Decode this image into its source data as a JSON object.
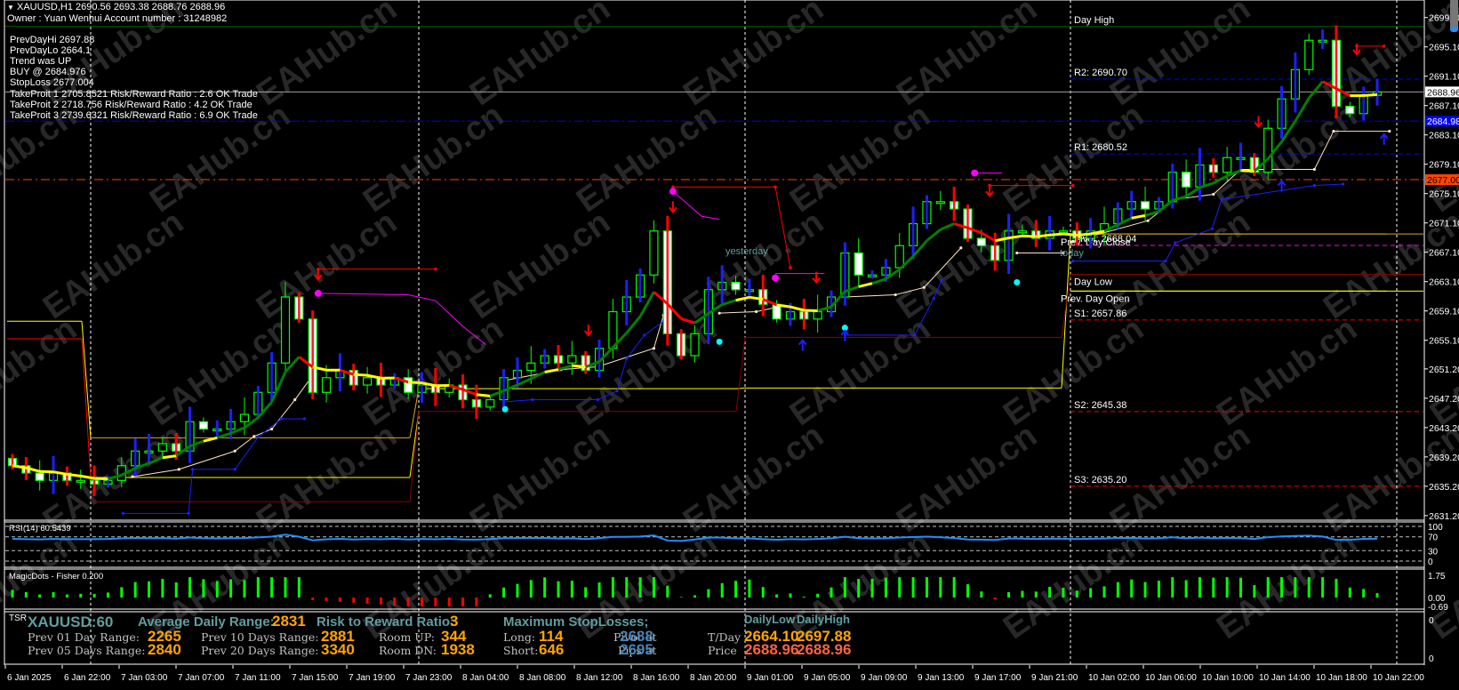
{
  "header": {
    "symbol_line": "XAUUSD,H1  2690.56 2693.38 2688.76 2688.96",
    "owner_line": "Owner : Yuan Wenhui Account number : 31248982"
  },
  "info_lines": [
    "PrevDayHi 2697.88",
    "PrevDayLo 2664.1",
    "Trend was UP",
    "BUY @ 2684.976",
    "StopLoss 2677.004",
    "TakeProit 1 2705.8521 Risk/Reward Ratio : 2.6 OK Trade",
    "TakeProit 2 2718.756 Risk/Reward Ratio : 4.2 OK Trade",
    "TakeProit 3 2739.6321 Risk/Reward Ratio : 6.9 OK Trade"
  ],
  "watermark": "EAHub.cn",
  "colors": {
    "bull_wick": "#1e1eff",
    "bear_wick": "#ff0000",
    "body_outline": "#00ff00",
    "ma_up": "#008000",
    "ma_down": "#ff0000",
    "ma_flat": "#ffff00"
  },
  "chart_data": {
    "type": "candlestick",
    "symbol": "XAUUSD",
    "timeframe": "H1",
    "closes": [
      2638,
      2637,
      2636,
      2637,
      2636,
      2636,
      2635.5,
      2636,
      2638,
      2640,
      2640,
      2641,
      2640,
      2644,
      2643,
      2643,
      2644,
      2645,
      2648,
      2652,
      2661,
      2658,
      2648,
      2650,
      2651,
      2649,
      2650,
      2649,
      2650,
      2648,
      2649,
      2648,
      2649,
      2647,
      2646,
      2647,
      2650,
      2651,
      2652,
      2653,
      2652,
      2653,
      2651,
      2654,
      2659,
      2661,
      2664,
      2670,
      2656,
      2653,
      2656,
      2662,
      2663,
      2662,
      2662,
      2660,
      2658,
      2659,
      2658,
      2659,
      2661,
      2667,
      2664,
      2664,
      2665,
      2668,
      2671,
      2674,
      2674,
      2673,
      2669,
      2668,
      2666,
      2670,
      2670,
      2669,
      2670,
      2670,
      2669,
      2670,
      2671,
      2673,
      2674,
      2673,
      2674,
      2678,
      2676,
      2679,
      2678,
      2680,
      2680,
      2678,
      2684,
      2688,
      2692,
      2696,
      2696,
      2687,
      2686,
      2688.5,
      2688.96
    ],
    "price_axis": [
      "2699.10",
      "2695.10",
      "2691.10",
      "2687.10",
      "2683.10",
      "2679.10",
      "2675.10",
      "2671.10",
      "2667.10",
      "2663.10",
      "2659.10",
      "2655.10",
      "2651.20",
      "2647.20",
      "2643.20",
      "2639.20",
      "2635.20",
      "2631.20"
    ],
    "price_tags": [
      {
        "text": "2688.96",
        "bg": "#ffffff",
        "fg": "#000000"
      },
      {
        "text": "2684.98",
        "bg": "#0000ff",
        "fg": "#ffffff"
      },
      {
        "text": "2677.00",
        "bg": "#ff4500",
        "fg": "#000000"
      }
    ],
    "time_axis": [
      "6 Jan 2025",
      "6 Jan 22:00",
      "7 Jan 03:00",
      "7 Jan 07:00",
      "7 Jan 11:00",
      "7 Jan 15:00",
      "7 Jan 19:00",
      "7 Jan 23:00",
      "8 Jan 04:00",
      "8 Jan 08:00",
      "8 Jan 12:00",
      "8 Jan 16:00",
      "8 Jan 20:00",
      "9 Jan 01:00",
      "9 Jan 05:00",
      "9 Jan 09:00",
      "9 Jan 13:00",
      "9 Jan 17:00",
      "9 Jan 21:00",
      "10 Jan 02:00",
      "10 Jan 06:00",
      "10 Jan 10:00",
      "10 Jan 14:00",
      "10 Jan 18:00",
      "10 Jan 22:00"
    ],
    "levels": [
      {
        "label": "Day High",
        "price": 2697.88,
        "color": "#006400",
        "style": "solid",
        "scope": "full"
      },
      {
        "label": "R2: 2690.70",
        "price": 2690.7,
        "color": "#0000ff",
        "style": "dash",
        "scope": "today"
      },
      {
        "label": "",
        "price": 2688.96,
        "color": "#a0a0a0",
        "style": "solid",
        "scope": "full"
      },
      {
        "label": "",
        "price": 2684.98,
        "color": "#0000ff",
        "style": "dashdot",
        "scope": "full"
      },
      {
        "label": "R1: 2680.52",
        "price": 2680.52,
        "color": "#0000ff",
        "style": "dash",
        "scope": "today"
      },
      {
        "label": "",
        "price": 2677.0,
        "color": "#ff4500",
        "style": "dashdot",
        "scope": "full"
      },
      {
        "label": "Prev. Day Close",
        "price": 2669.6,
        "color": "#daa520",
        "style": "solid",
        "scope": "today"
      },
      {
        "label": "Pivot: 2668.04",
        "price": 2668.04,
        "color": "#ff00ff",
        "style": "dash",
        "scope": "today"
      },
      {
        "label": "Day Low",
        "price": 2664.1,
        "color": "#8b0000",
        "style": "solid",
        "scope": "today"
      },
      {
        "label": "Prev. Day Open",
        "price": 2661.8,
        "color": "#ffff00",
        "style": "solid",
        "scope": "today"
      },
      {
        "label": "S1: 2657.86",
        "price": 2657.86,
        "color": "#ff0000",
        "style": "dash",
        "scope": "today"
      },
      {
        "label": "S2: 2645.38",
        "price": 2645.38,
        "color": "#ff0000",
        "style": "dash",
        "scope": "today"
      },
      {
        "label": "S3: 2635.20",
        "price": 2635.2,
        "color": "#ff0000",
        "style": "dash",
        "scope": "today"
      }
    ],
    "today_label": "today",
    "yesterday_label": "yesterday",
    "day_levels": [
      [
        {
          "p": 2657.7,
          "c": "#ffff00"
        },
        {
          "p": 2655.3,
          "c": "#ff0000"
        }
      ],
      [
        {
          "p": 2641.8,
          "c": "#daa520"
        },
        {
          "p": 2636.4,
          "c": "#ffff00"
        },
        {
          "p": 2633.1,
          "c": "#8b0000"
        }
      ],
      [
        {
          "p": 2648.5,
          "c": "#ffff00"
        },
        {
          "p": 2645.4,
          "c": "#8b0000"
        }
      ],
      [
        {
          "p": 2648.6,
          "c": "#ffff00"
        },
        {
          "p": 2655.5,
          "c": "#8b0000"
        }
      ],
      [
        {
          "p": 2669.6,
          "c": "#daa520"
        },
        {
          "p": 2664.1,
          "c": "#8b0000"
        },
        {
          "p": 2661.8,
          "c": "#ffff00"
        }
      ]
    ],
    "trail_white": [
      [
        [
          8.8,
          2636.5
        ],
        [
          12.2,
          2637.5
        ],
        [
          16.3,
          2640
        ],
        [
          17.7,
          2642
        ],
        [
          19,
          2643
        ],
        [
          20.7,
          2647
        ],
        [
          21.8,
          2649.8
        ]
      ],
      [
        [
          36,
          2649.6
        ],
        [
          40.2,
          2651.1
        ],
        [
          42.9,
          2651.5
        ],
        [
          47,
          2654
        ],
        [
          47.7,
          2658.5
        ]
      ],
      [
        [
          51.8,
          2658.8
        ],
        [
          54.5,
          2659
        ],
        [
          56.5,
          2659.8
        ]
      ],
      [
        [
          61,
          2661
        ],
        [
          64.7,
          2661.3
        ],
        [
          66.8,
          2662.3
        ],
        [
          69.5,
          2667.7
        ]
      ],
      [
        [
          73.6,
          2667
        ],
        [
          77,
          2667
        ]
      ],
      [
        [
          77.7,
          2668.6
        ],
        [
          83.2,
          2671.4
        ],
        [
          85.2,
          2674.3
        ],
        [
          88,
          2675
        ],
        [
          90,
          2678.4
        ],
        [
          95.4,
          2678.4
        ],
        [
          96.8,
          2683.6
        ],
        [
          100.9,
          2683.6
        ]
      ]
    ],
    "trail_blue": [
      [
        [
          8.1,
          2631.5
        ],
        [
          12.9,
          2631.5
        ],
        [
          13.2,
          2637.5
        ],
        [
          16.3,
          2637.5
        ],
        [
          18,
          2641.9
        ],
        [
          19.7,
          2644.4
        ],
        [
          21.4,
          2644.4
        ]
      ],
      [
        [
          36,
          2646.7
        ],
        [
          38.1,
          2647
        ],
        [
          42.9,
          2647
        ],
        [
          44.3,
          2648.2
        ],
        [
          45,
          2652.6
        ],
        [
          46.3,
          2655.8
        ],
        [
          47.7,
          2657.7
        ]
      ],
      [
        [
          61,
          2655.8
        ],
        [
          66.1,
          2655.8
        ],
        [
          67.5,
          2660.8
        ],
        [
          68.1,
          2663.3
        ]
      ],
      [
        [
          77.7,
          2665.9
        ],
        [
          84.5,
          2665.9
        ],
        [
          85.2,
          2668.4
        ],
        [
          87.9,
          2670.3
        ],
        [
          88.6,
          2674.3
        ],
        [
          95.4,
          2676.2
        ],
        [
          97.5,
          2676.4
        ]
      ]
    ],
    "down_arrows": [
      [
        22.4,
        2664
      ],
      [
        42.2,
        2656.4
      ],
      [
        48.4,
        2673.2
      ],
      [
        58.9,
        2663.6
      ],
      [
        71.6,
        2675.4
      ],
      [
        91.3,
        2684.8
      ],
      [
        98.5,
        2694.7
      ]
    ],
    "up_arrows": [
      [
        57.9,
        2654.5
      ],
      [
        61,
        2655.8
      ],
      [
        93,
        2676.2
      ],
      [
        100.5,
        2682.6
      ]
    ],
    "red_lines": [
      [
        [
          22.4,
          2664.8
        ],
        [
          31,
          2664.8
        ]
      ],
      [
        [
          48.4,
          2676
        ],
        [
          55.9,
          2676
        ],
        [
          57,
          2665
        ]
      ],
      [
        [
          71.6,
          2676.2
        ],
        [
          77.7,
          2676.2
        ]
      ],
      [
        [
          98.5,
          2695.2
        ],
        [
          100.5,
          2695.2
        ]
      ]
    ],
    "magenta_lines": [
      [
        [
          22.4,
          2661.5
        ],
        [
          29,
          2661.3
        ],
        [
          31,
          2660.5
        ],
        [
          33,
          2657
        ],
        [
          34.7,
          2654.5
        ]
      ],
      [
        [
          48.4,
          2675.4
        ],
        [
          50.5,
          2672
        ],
        [
          51.8,
          2671.6
        ]
      ],
      [
        [
          55.9,
          2664.2
        ],
        [
          59.5,
          2664.2
        ]
      ],
      [
        [
          70.5,
          2677.9
        ],
        [
          72.5,
          2677.9
        ]
      ]
    ],
    "magenta_dots": [
      [
        22.4,
        2661.5
      ],
      [
        48.4,
        2675.4
      ],
      [
        55.9,
        2663.6
      ],
      [
        70.5,
        2677.9
      ]
    ],
    "cyan_dots": [
      [
        36.1,
        2645.7
      ],
      [
        51.8,
        2654.9
      ],
      [
        61,
        2656.8
      ],
      [
        73.6,
        2663
      ]
    ]
  },
  "rsi": {
    "label": "RSI(14) 60.5439",
    "axis": [
      "100",
      "70",
      "30",
      "0"
    ],
    "levels": [
      100,
      70,
      30,
      0
    ]
  },
  "magic": {
    "label": "MagicDots - Fisher 0.200",
    "axis": [
      "1.75",
      "0.00",
      "-0.69"
    ]
  },
  "tsr": {
    "tag": "TSR",
    "symbol": "XAUUSD:60",
    "adr_label": "Average Daily Range:",
    "adr_value": "2831",
    "rr_label": "Risk to Reward Ratio:",
    "rr_value": "3",
    "max_sl_label": "Maximum StopLosses;",
    "prev01_label": "Prev 01 Day Range:",
    "prev01_value": "2265",
    "prev05_label": "Prev 05 Days Range:",
    "prev05_value": "2840",
    "prev10_label": "Prev 10 Days Range:",
    "prev10_value": "2881",
    "prev20_label": "Prev 20 Days Range:",
    "prev20_value": "3340",
    "room_up_label": "Room UP:",
    "room_up_value": "344",
    "room_dn_label": "Room DN:",
    "room_dn_value": "1938",
    "long_label": "Long:",
    "long_value": "114",
    "short_label": "Short:",
    "short_value": "646",
    "pivot_label": "Pivot at",
    "pivot_value": "2688",
    "pips_label": "Pips at",
    "pips_value": "2695",
    "daily_low_label": "DailyLow",
    "daily_high_label": "DailyHigh",
    "tday_label": "T/Day",
    "tday_low": "2664.10",
    "tday_high": "2697.88",
    "price_label": "Price",
    "price_low": "2688.96",
    "price_high": "2688.96",
    "axis_top": "0",
    "axis_bottom": "0"
  }
}
